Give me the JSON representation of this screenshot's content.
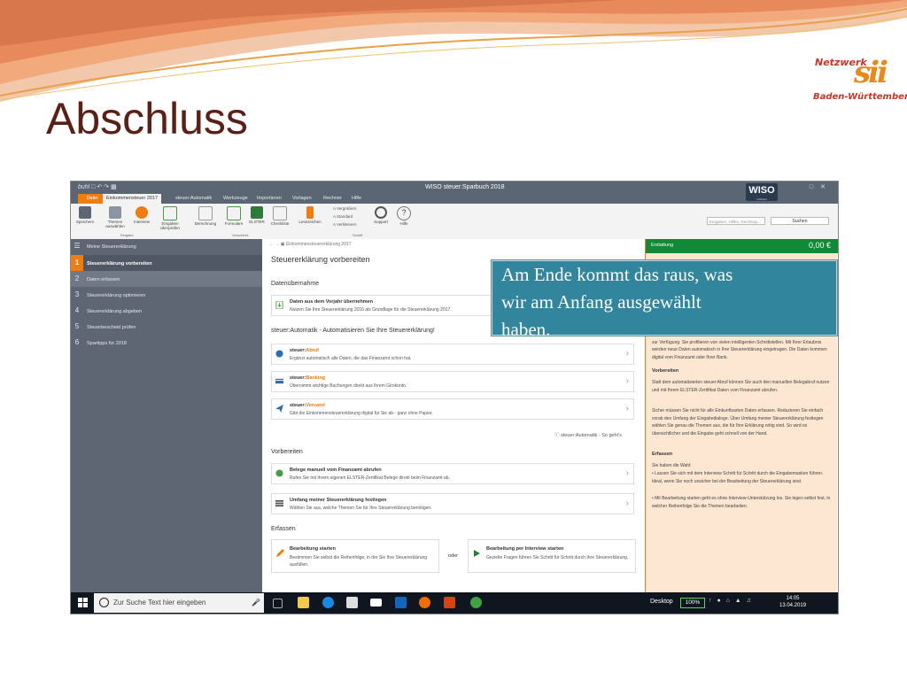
{
  "slide": {
    "title": "Abschluss",
    "logo_top": "Netzwerk",
    "logo_mark": "sii",
    "logo_bottom": "Baden-Württemberg",
    "callout": [
      "Am Ende kommt das raus, was",
      "wir am Anfang ausgewählt",
      "haben."
    ]
  },
  "app": {
    "brand": "buhl",
    "title": "WISO steuer:Sparbuch 2018",
    "wiso_logo": "WISO",
    "wiso_sub": "software"
  },
  "menu": [
    {
      "label": "Datei"
    },
    {
      "label": "Einkommensteuer 2017"
    },
    {
      "label": "steuer:Automatik"
    },
    {
      "label": "Werkzeuge"
    },
    {
      "label": "Importieren"
    },
    {
      "label": "Vorlagen"
    },
    {
      "label": "Rechner"
    },
    {
      "label": "Hilfe"
    }
  ],
  "ribbon": {
    "buttons": [
      {
        "label": "Speichern"
      },
      {
        "label": "Themen auswählen"
      },
      {
        "label": "Interview"
      },
      {
        "label": "Eingaben überprüfen"
      },
      {
        "label": "Berechnung"
      },
      {
        "label": "Formulare"
      },
      {
        "label": "ELSTER"
      },
      {
        "label": "Checkliste"
      },
      {
        "label": "Lesezeichen"
      },
      {
        "label": "Support"
      },
      {
        "label": "Hilfe"
      }
    ],
    "font_options": [
      "Vergrößern",
      "Standard",
      "Verkleinern"
    ],
    "groups": [
      "Eingabe",
      "Vorschicht",
      "Schrift"
    ],
    "search_placeholder": "Eingaben, Hilfen, Rechtsqu...",
    "search_button": "Suchen"
  },
  "sidebar": {
    "header": "Meine Steuererklärung",
    "items": [
      {
        "num": "1",
        "label": "Steuererklärung vorbereiten"
      },
      {
        "num": "2",
        "label": "Daten erfassen"
      },
      {
        "num": "3",
        "label": "Steuererklärung optimieren"
      },
      {
        "num": "4",
        "label": "Steuererklärung abgeben"
      },
      {
        "num": "5",
        "label": "Steuerbescheid prüfen"
      },
      {
        "num": "6",
        "label": "Spartipps für 2018"
      }
    ]
  },
  "main": {
    "breadcrumb": "Einkommensteuererklärung 2017",
    "heading": "Steuererklärung vorbereiten",
    "section1": "Datenübernahme",
    "card1": {
      "title": "Daten aus dem Vorjahr übernehmen",
      "sub": "Nutzen Sie Ihre Steuererklärung 2016 als Grundlage für die Steuererklärung 2017."
    },
    "section2": "steuer:Automatik - Automatisieren Sie Ihre Steuererklärung!",
    "automatik": [
      {
        "prefix": "steuer:",
        "name": "Abruf",
        "sub": "Ergänzt automatisch alle Daten, die das Finanzamt schon hat."
      },
      {
        "prefix": "steuer:",
        "name": "Banking",
        "sub": "Übernimmt wichtige Buchungen direkt aus Ihrem Girokonto."
      },
      {
        "prefix": "steuer:",
        "name": "Versand",
        "sub": "Gibt die Einkommensteuererklärung digital für Sie ab - ganz ohne Papier."
      }
    ],
    "automatik_note": "steuer:Automatik - So geht's",
    "section3": "Vorbereiten",
    "prep": [
      {
        "title": "Belege manuell vom Finanzamt abrufen",
        "sub": "Rufen Sie mit Ihrem eigenen ELSTER-Zertifikat Belege direkt beim Finanzamt ab."
      },
      {
        "title": "Umfang meiner Steuererklärung festlegen",
        "sub": "Wählen Sie aus, welche Themen Sie für Ihre Steuererklärung benötigen."
      }
    ],
    "section4": "Erfassen",
    "start": {
      "title": "Bearbeitung starten",
      "sub": "Bestimmen Sie selbst die Reihenfolge, in der Sie Ihre Steuererklärung ausfüllen."
    },
    "or": "oder",
    "interview": {
      "title": "Bearbeitung per Interview starten",
      "sub": "Gezielte Fragen führen Sie Schritt für Schritt durch Ihre Steuererklärung."
    }
  },
  "right": {
    "label": "Erstattung",
    "value": "0,00 €",
    "intro": "In Ihrer steuer:Automatik stehen Ihnen wichtige Abruf-, Banking- und Versand-Funktionen zur Verfügung. Sie profitieren von vielen intelligenten Schnittstellen. Mit Ihrer Erlaubnis werden neue Daten automatisch in Ihre Steuererklärung eingetragen. Die Daten kommen digital vom Finanzamt oder Ihrer Bank.",
    "s1": "Vorbereiten",
    "t1": "Statt dem automatisierten steuer:Abruf können Sie auch den manuellen Belegabruf nutzen und mit Ihrem ELSTER-Zertifikat Daten vom Finanzamt abrufen.",
    "t2": "Sicher müssen Sie nicht für alle Einkunftsarten Daten erfassen. Reduzieren Sie einfach vorab den Umfang der Eingabedialoge. Über Umfang meiner Steuererklärung festlegen wählen Sie genau die Themen aus, die für Ihre Erklärung nötig sind. So wird es übersichtlicher und die Eingabe geht schnell von der Hand.",
    "s2": "Erfassen",
    "t3": "Sie haben die Wahl:",
    "b1": "• Lassen Sie sich mit dem Interview Schritt für Schritt durch die Eingabemasken führen. Ideal, wenn Sie noch unsicher bei der Bearbeitung der Steuererklärung sind.",
    "b2": "• Mit Bearbeitung starten geht es ohne Interview-Unterstützung los. Sie legen selbst fest, in welcher Reihenfolge Sie die Themen bearbeiten."
  },
  "taskbar": {
    "search_placeholder": "Zur Suche Text hier eingeben",
    "desktop": "Desktop",
    "battery": "100%",
    "time": "14:05",
    "date": "13.04.2019"
  },
  "colors": {
    "accent": "#ef7d12",
    "sidebar": "#5e6673",
    "refund": "#108a36",
    "callout": "#31859c",
    "title": "#5a2018"
  }
}
